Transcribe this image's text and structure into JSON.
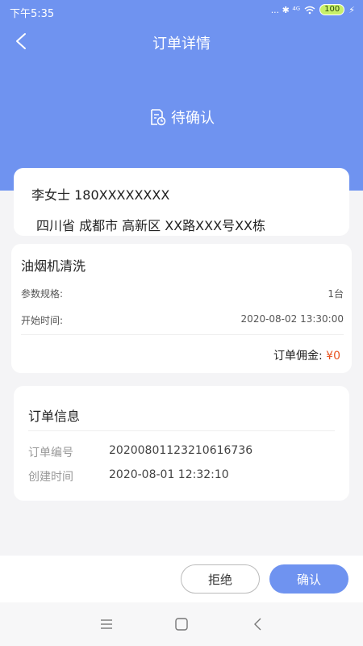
{
  "status_bar": {
    "time": "下午5:35",
    "indicators": "... ✱ ⁴ᴳ",
    "battery": "100"
  },
  "header": {
    "title": "订单详情",
    "order_status": "待确认"
  },
  "address": {
    "contact": "李女士 180XXXXXXXX",
    "address": "四川省 成都市 高新区 XX路XXX号XX栋"
  },
  "service": {
    "name": "油烟机清洗",
    "rows": [
      {
        "label": "参数规格:",
        "value": "1台"
      },
      {
        "label": "开始时间:",
        "value": "2020-08-02 13:30:00"
      }
    ],
    "commission_label": "订单佣金:",
    "commission_value": "¥0"
  },
  "order_info": {
    "title": "订单信息",
    "rows": [
      {
        "label": "订单编号",
        "value": "20200801123210616736"
      },
      {
        "label": "创建时间",
        "value": "2020-08-01 12:32:10"
      }
    ]
  },
  "actions": {
    "reject_label": "拒绝",
    "confirm_label": "确认"
  },
  "colors": {
    "accent": "#6f93f0",
    "price": "#e8531f"
  }
}
